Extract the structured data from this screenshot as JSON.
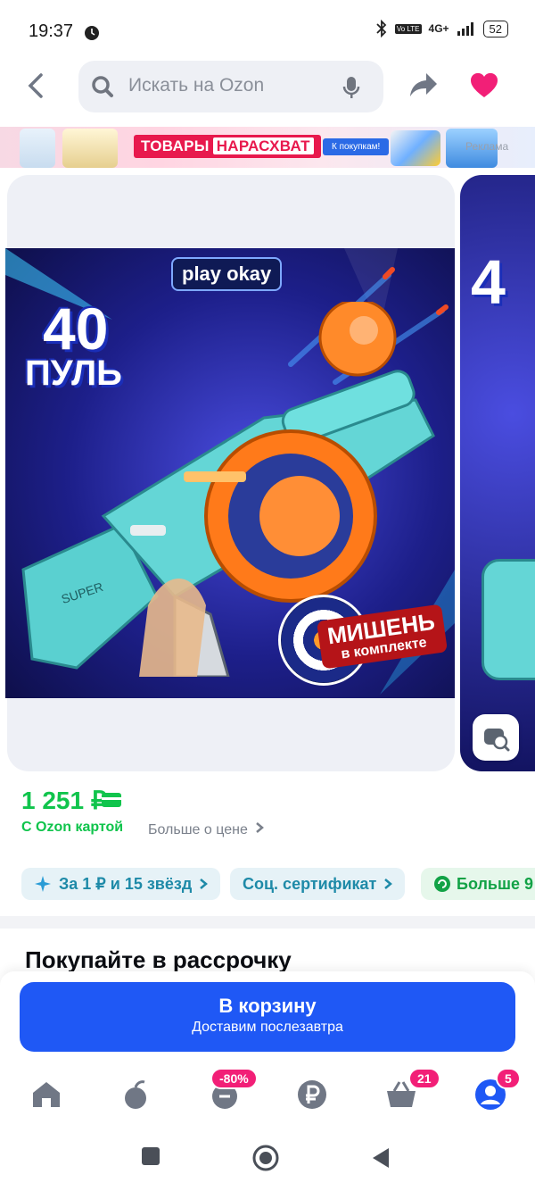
{
  "status_bar": {
    "time": "19:37",
    "network": "4G+",
    "battery": "52"
  },
  "search": {
    "placeholder": "Искать на Ozon"
  },
  "promo": {
    "title_part1": "ТОВАРЫ",
    "title_part2": "НАРАСХВАТ",
    "cta": "К покупкам!",
    "ad_label": "Реклама"
  },
  "gallery": {
    "brand": "play okay",
    "badge_top": "40",
    "badge_bottom": "ПУЛЬ",
    "target_line1": "МИШЕНЬ",
    "target_line2": "в комплекте",
    "gun_label": "SUPER"
  },
  "price": {
    "value": "1 251 ₽",
    "ozon_card": "С Ozon картой",
    "more": "Больше о цене"
  },
  "chips": [
    {
      "label": "За 1 ₽ и 15 звёзд"
    },
    {
      "label": "Соц. сертификат"
    },
    {
      "label": "Больше 9"
    }
  ],
  "section": {
    "title": "Покупайте в рассрочку"
  },
  "cart": {
    "label": "В корзину",
    "delivery": "Доставим послезавтра"
  },
  "bottom_nav": {
    "badges": {
      "discounts": "-80%",
      "cart": "21",
      "profile": "5"
    }
  },
  "colors": {
    "accent": "#1f58f5",
    "price": "#10c44c",
    "heart": "#f21f77"
  }
}
